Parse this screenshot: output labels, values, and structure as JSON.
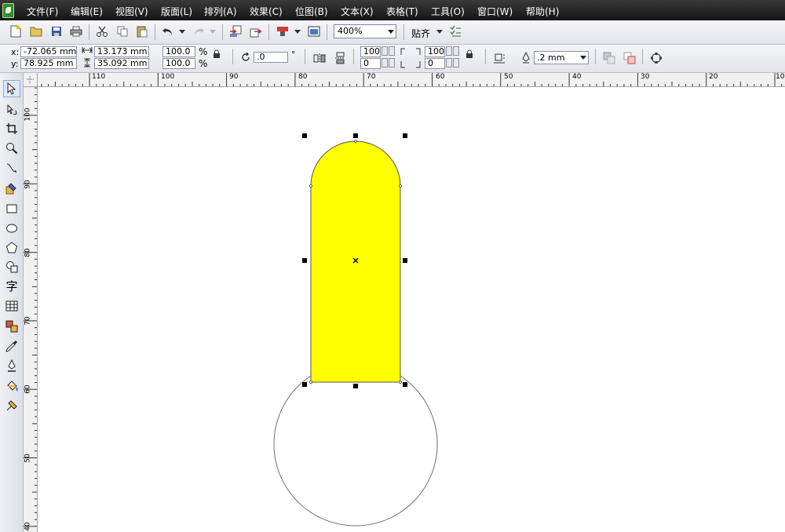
{
  "menu": [
    "文件(F)",
    "编辑(E)",
    "视图(V)",
    "版面(L)",
    "排列(A)",
    "效果(C)",
    "位图(B)",
    "文本(X)",
    "表格(T)",
    "工具(O)",
    "窗口(W)",
    "帮助(H)"
  ],
  "toolbar": {
    "zoom": "400%",
    "snap_label": "贴齐"
  },
  "properties": {
    "x_label": "x:",
    "x": "-72.065 mm",
    "y_label": "y:",
    "y": "78.925 mm",
    "width": "13.173 mm",
    "height": "35.092 mm",
    "scale_x": "100.0",
    "scale_y": "100.0",
    "percent": "%",
    "rotation": ".0",
    "degree": "°",
    "corner_tl": "100",
    "corner_bl": "0",
    "corner_tr": "100",
    "corner_br": "0",
    "outline_width": ".2 mm"
  },
  "ruler_top": [
    "110",
    "100",
    "90",
    "80",
    "70",
    "60",
    "50",
    "40",
    "30",
    "20",
    "10"
  ],
  "ruler_left": [
    "100",
    "90",
    "80",
    "70",
    "60",
    "50",
    "40"
  ],
  "toolbox": [
    "pick-tool",
    "shape-tool",
    "crop-tool",
    "zoom-tool",
    "freehand-tool",
    "smart-fill-tool",
    "rectangle-tool",
    "ellipse-tool",
    "polygon-tool",
    "basic-shapes-tool",
    "text-tool",
    "table-tool",
    "interactive-blend-tool",
    "eyedropper-tool",
    "outline-pen-tool",
    "fill-tool",
    "interactive-fill-tool"
  ],
  "text_tool_glyph": "字",
  "shape_fill": "#ffff00",
  "accent": "#3a6fcf"
}
